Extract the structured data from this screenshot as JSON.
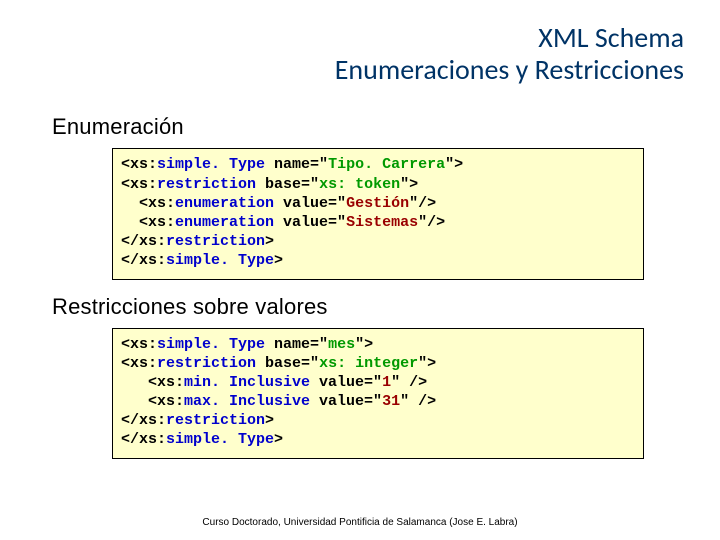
{
  "title": {
    "line1": "XML Schema",
    "line2": "Enumeraciones y Restricciones"
  },
  "section1": {
    "heading": "Enumeración",
    "code": {
      "l1a": "<xs:",
      "l1b": "simple. Type",
      "l1c": " name=\"",
      "l1d": "Tipo. Carrera",
      "l1e": "\">",
      "l2a": "<xs:",
      "l2b": "restriction",
      "l2c": " base=\"",
      "l2d": "xs: token",
      "l2e": "\">",
      "l3a": "  <xs:",
      "l3b": "enumeration",
      "l3c": " value=\"",
      "l3d": "Gestión",
      "l3e": "\"/>",
      "l4a": "  <xs:",
      "l4b": "enumeration",
      "l4c": " value=\"",
      "l4d": "Sistemas",
      "l4e": "\"/>",
      "l5a": "</xs:",
      "l5b": "restriction",
      "l5c": ">",
      "l6a": "</xs:",
      "l6b": "simple. Type",
      "l6c": ">"
    }
  },
  "section2": {
    "heading": "Restricciones sobre valores",
    "code": {
      "l1a": "<xs:",
      "l1b": "simple. Type",
      "l1c": " name=\"",
      "l1d": "mes",
      "l1e": "\">",
      "l2a": "<xs:",
      "l2b": "restriction",
      "l2c": " base=\"",
      "l2d": "xs: integer",
      "l2e": "\">",
      "l3a": "   <xs:",
      "l3b": "min. Inclusive",
      "l3c": " value=\"",
      "l3d": "1",
      "l3e": "\" />",
      "l4a": "   <xs:",
      "l4b": "max. Inclusive",
      "l4c": " value=\"",
      "l4d": "31",
      "l4e": "\" />",
      "l5a": "</xs:",
      "l5b": "restriction",
      "l5c": ">",
      "l6a": "</xs:",
      "l6b": "simple. Type",
      "l6c": ">"
    }
  },
  "footer": "Curso Doctorado, Universidad Pontificia de Salamanca (Jose E. Labra)"
}
